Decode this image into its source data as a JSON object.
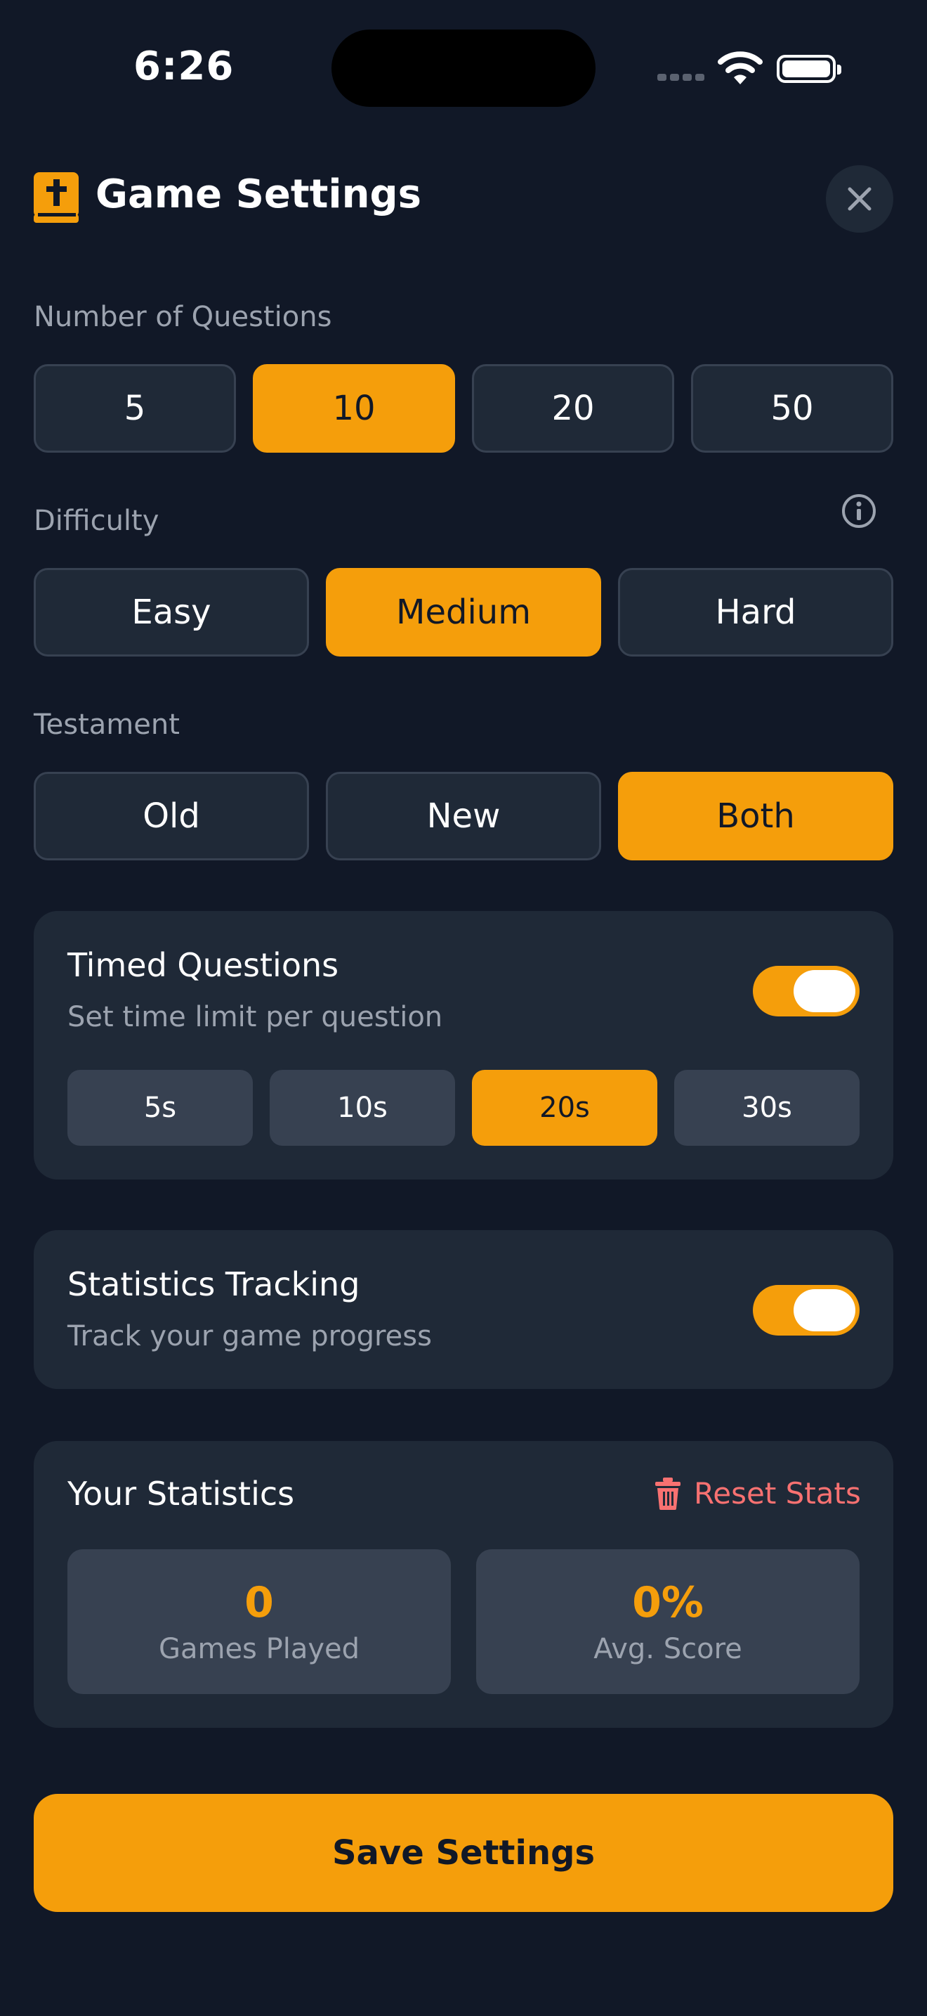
{
  "status_bar": {
    "time": "6:26"
  },
  "header": {
    "title": "Game Settings",
    "logo_icon": "bible-icon",
    "close_icon": "close-icon"
  },
  "questions": {
    "label": "Number of Questions",
    "options": [
      "5",
      "10",
      "20",
      "50"
    ],
    "selected": "10"
  },
  "difficulty": {
    "label": "Difficulty",
    "options": [
      "Easy",
      "Medium",
      "Hard"
    ],
    "selected": "Medium",
    "info_icon": "info-icon"
  },
  "testament": {
    "label": "Testament",
    "options": [
      "Old",
      "New",
      "Both"
    ],
    "selected": "Both"
  },
  "timed": {
    "title": "Timed Questions",
    "subtitle": "Set time limit per question",
    "enabled": true,
    "options": [
      "5s",
      "10s",
      "20s",
      "30s"
    ],
    "selected": "20s"
  },
  "tracking": {
    "title": "Statistics Tracking",
    "subtitle": "Track your game progress",
    "enabled": true
  },
  "stats": {
    "title": "Your Statistics",
    "reset_label": "Reset Stats",
    "reset_icon": "trash-icon",
    "games_played_value": "0",
    "games_played_label": "Games Played",
    "avg_score_value": "0%",
    "avg_score_label": "Avg. Score"
  },
  "save_label": "Save Settings",
  "colors": {
    "background": "#111827",
    "card": "#1f2937",
    "accent": "#f59e0b",
    "danger": "#f87171",
    "muted": "#9ca3af"
  }
}
